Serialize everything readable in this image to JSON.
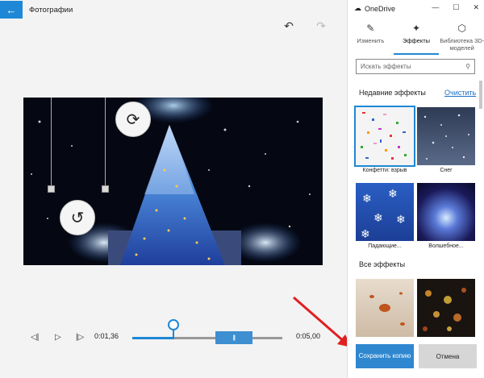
{
  "app": {
    "title": "Фотографии"
  },
  "window": {
    "onedrive_label": "OneDrive"
  },
  "tabs": [
    {
      "label": "Изменить",
      "icon": "pencil-icon"
    },
    {
      "label": "Эффекты",
      "icon": "sparkle-icon"
    },
    {
      "label": "Библиотека 3D-моделей",
      "icon": "cube-icon"
    }
  ],
  "search": {
    "placeholder": "Искать эффекты"
  },
  "recent": {
    "title": "Недавние эффекты",
    "clear_label": "Очистить",
    "items": [
      {
        "label": "Конфетти: взрыв"
      },
      {
        "label": "Снег"
      },
      {
        "label": "Падающие..."
      },
      {
        "label": "Волшебное..."
      }
    ]
  },
  "all": {
    "title": "Все эффекты"
  },
  "timeline": {
    "current_time": "0:01,36",
    "end_time": "0:05,00",
    "playhead_fraction": 0.272,
    "trim_start_fraction": 0.75,
    "trim_end_fraction": 1.0
  },
  "actions": {
    "save_label": "Сохранить копию",
    "cancel_label": "Отмена"
  },
  "colors": {
    "accent": "#1e88d6",
    "arrow": "#e02020"
  }
}
